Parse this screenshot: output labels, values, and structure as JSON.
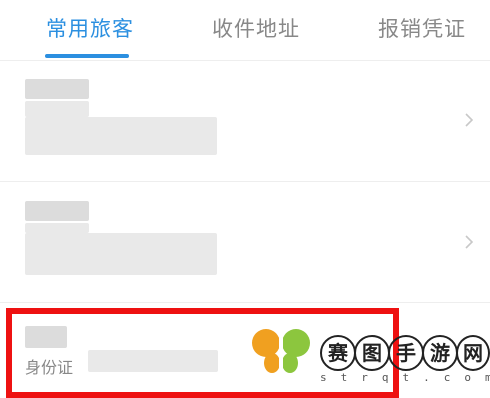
{
  "tabs": [
    {
      "label": "常用旅客",
      "active": true
    },
    {
      "label": "收件地址",
      "active": false
    },
    {
      "label": "报销凭证",
      "active": false
    }
  ],
  "accent_color": "#2b8fe0",
  "highlight_color": "#ee1111",
  "list": {
    "items": [
      {
        "chevron_icon": "chevron-right-icon"
      },
      {
        "chevron_icon": "chevron-right-icon"
      },
      {
        "id_label": "身份证"
      }
    ]
  },
  "watermark": {
    "chars": [
      "赛",
      "图",
      "手",
      "游",
      "网"
    ],
    "subtitle": "strqt.com",
    "logo_icon": "butterfly-logo-icon"
  }
}
